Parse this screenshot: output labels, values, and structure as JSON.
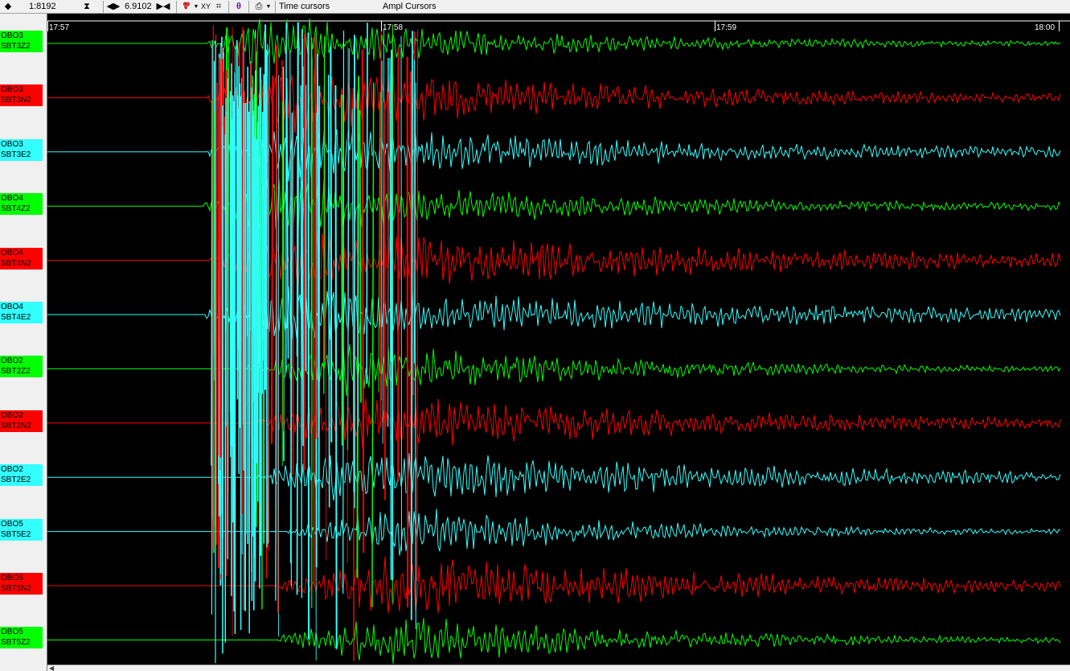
{
  "toolbar": {
    "scale_value": "1:8192",
    "time_value": "6.9102",
    "time_cursors_label": "Time cursors",
    "ampl_cursors_label": "Ampl Cursors"
  },
  "time_axis": {
    "ticks": [
      "17:57",
      "17:58",
      "17:59",
      "18:00"
    ]
  },
  "colors": {
    "green": "#00ff00",
    "red": "#ff0000",
    "cyan": "#33ffff",
    "background": "#000000"
  },
  "channels": [
    {
      "station": "OBO3",
      "channel": "SBT3Z2",
      "color": "#00ff00"
    },
    {
      "station": "OBO3",
      "channel": "SBT3N2",
      "color": "#ff0000"
    },
    {
      "station": "OBO3",
      "channel": "SBT3E2",
      "color": "#33ffff"
    },
    {
      "station": "OBO4",
      "channel": "SBT4Z2",
      "color": "#00ff00"
    },
    {
      "station": "OBO4",
      "channel": "SBT4N2",
      "color": "#ff0000"
    },
    {
      "station": "OBO4",
      "channel": "SBT4E2",
      "color": "#33ffff"
    },
    {
      "station": "OBO2",
      "channel": "SBT2Z2",
      "color": "#00ff00"
    },
    {
      "station": "OBO2",
      "channel": "SBT2N2",
      "color": "#ff0000"
    },
    {
      "station": "OBO2",
      "channel": "SBT2E2",
      "color": "#33ffff"
    },
    {
      "station": "OBO5",
      "channel": "SBT5E2",
      "color": "#33ffff"
    },
    {
      "station": "OBO5",
      "channel": "SBT5N2",
      "color": "#ff0000"
    },
    {
      "station": "OBO5",
      "channel": "SBT5Z2",
      "color": "#00ff00"
    }
  ]
}
